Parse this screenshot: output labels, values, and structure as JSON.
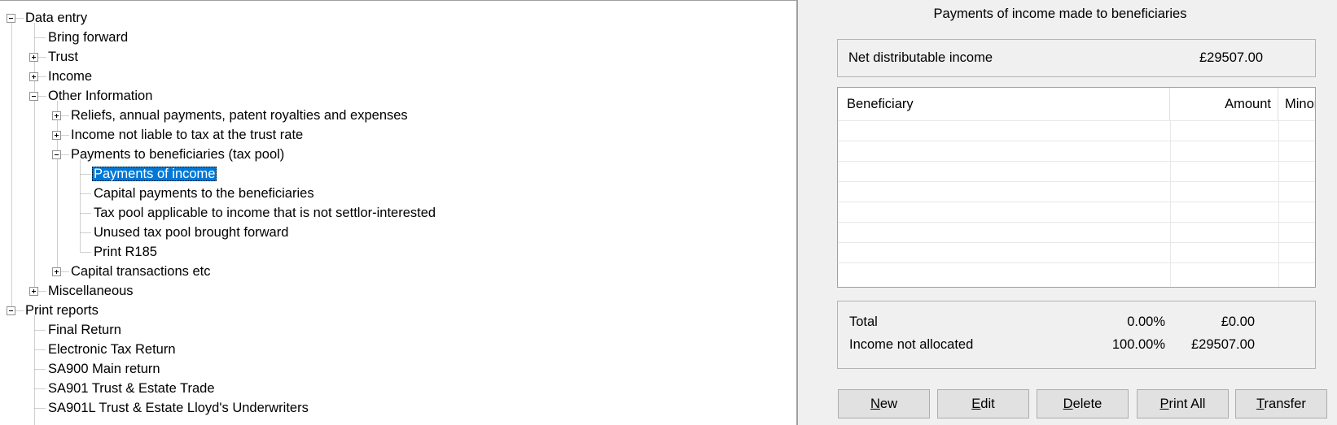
{
  "tree": {
    "items": [
      {
        "label": "Data entry",
        "level": 0,
        "expander": "minus"
      },
      {
        "label": "Bring forward",
        "level": 1,
        "expander": "none"
      },
      {
        "label": "Trust",
        "level": 1,
        "expander": "plus"
      },
      {
        "label": "Income",
        "level": 1,
        "expander": "plus"
      },
      {
        "label": "Other Information",
        "level": 1,
        "expander": "minus"
      },
      {
        "label": "Reliefs, annual payments, patent royalties and expenses",
        "level": 2,
        "expander": "plus"
      },
      {
        "label": "Income not liable to tax at the trust rate",
        "level": 2,
        "expander": "plus"
      },
      {
        "label": "Payments to beneficiaries (tax pool)",
        "level": 2,
        "expander": "minus"
      },
      {
        "label": "Payments of income",
        "level": 3,
        "expander": "none",
        "selected": true
      },
      {
        "label": "Capital payments to the beneficiaries",
        "level": 3,
        "expander": "none"
      },
      {
        "label": "Tax pool applicable to income that is not settlor-interested",
        "level": 3,
        "expander": "none"
      },
      {
        "label": "Unused tax pool brought forward",
        "level": 3,
        "expander": "none"
      },
      {
        "label": "Print R185",
        "level": 3,
        "expander": "none"
      },
      {
        "label": "Capital transactions etc",
        "level": 2,
        "expander": "plus"
      },
      {
        "label": "Miscellaneous",
        "level": 1,
        "expander": "plus"
      },
      {
        "label": "Print reports",
        "level": 0,
        "expander": "minus"
      },
      {
        "label": "Final Return",
        "level": 1,
        "expander": "none"
      },
      {
        "label": "Electronic Tax Return",
        "level": 1,
        "expander": "none"
      },
      {
        "label": "SA900 Main return",
        "level": 1,
        "expander": "none"
      },
      {
        "label": "SA901 Trust & Estate Trade",
        "level": 1,
        "expander": "none"
      },
      {
        "label": "SA901L Trust & Estate Lloyd's Underwriters",
        "level": 1,
        "expander": "none"
      }
    ]
  },
  "panel": {
    "title": "Payments of income made to beneficiaries",
    "net_label": "Net distributable income",
    "net_value": "£29507.00",
    "grid": {
      "columns": [
        "Beneficiary",
        "Amount",
        "Minor"
      ],
      "rows": []
    },
    "totals": [
      {
        "label": "Total",
        "percent": "0.00%",
        "amount": "£0.00"
      },
      {
        "label": "Income not allocated",
        "percent": "100.00%",
        "amount": "£29507.00"
      }
    ],
    "buttons": [
      {
        "label": "New",
        "mnemonic": "N"
      },
      {
        "label": "Edit",
        "mnemonic": "E"
      },
      {
        "label": "Delete",
        "mnemonic": "D"
      },
      {
        "label": "Print All",
        "mnemonic": "P"
      },
      {
        "label": "Transfer",
        "mnemonic": "T"
      }
    ]
  },
  "colors": {
    "selection": "#0078d7",
    "tree_line": "#a0a0a0"
  }
}
